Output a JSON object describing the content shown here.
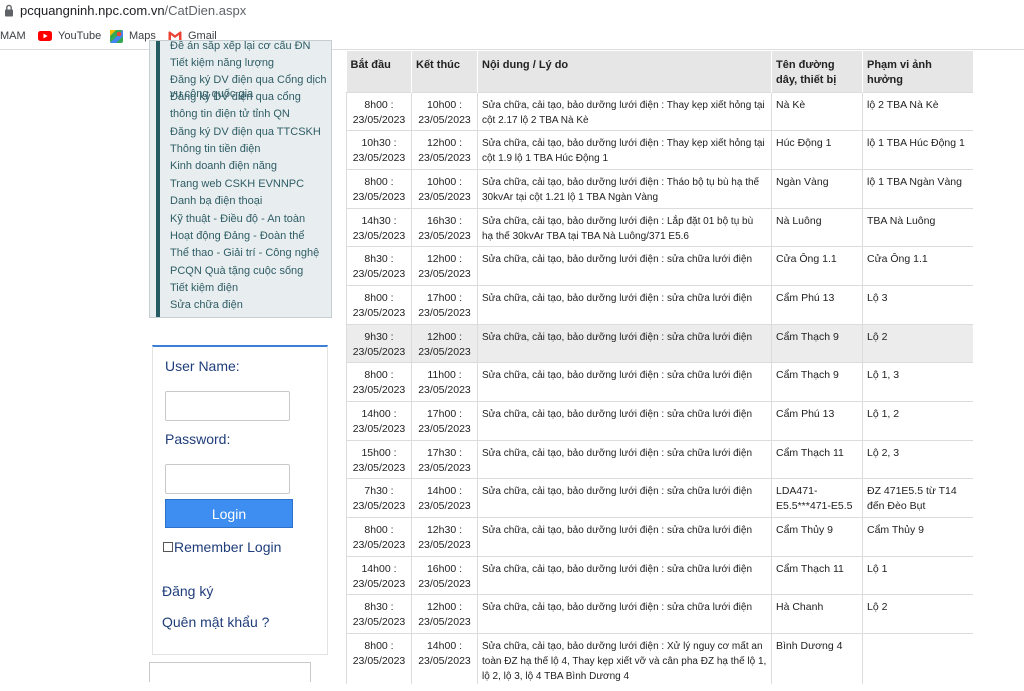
{
  "browser": {
    "url_host": "pcquangninh.npc.com.vn",
    "url_path": "/CatDien.aspx",
    "bookmarks": [
      {
        "label": "MAM",
        "icon": "none"
      },
      {
        "label": "YouTube",
        "icon": "youtube-icon"
      },
      {
        "label": "Maps",
        "icon": "maps-icon"
      },
      {
        "label": "Gmail",
        "icon": "gmail-icon"
      }
    ]
  },
  "sidebar": {
    "menu_items": [
      "Đề án sắp xếp lại cơ cấu ĐN",
      "Tiết kiệm năng lượng",
      "Đăng ký DV điện qua Cổng dịch vụ công quốc gia",
      "Đăng ký DV điện qua cổng",
      "thông tin điện tử tỉnh QN",
      "Đăng ký DV điện qua TTCSKH",
      "Thông tin tiền điện",
      "Kinh doanh điện năng",
      "Trang web CSKH EVNNPC",
      "Danh bạ điện thoại",
      "Kỹ thuật - Điều độ - An toàn",
      "Hoạt động Đảng - Đoàn thể",
      "Thể thao - Giải trí - Công nghệ",
      "PCQN Quà tặng cuộc sống",
      "Tiết kiệm điện",
      "Sửa chữa điện"
    ]
  },
  "login": {
    "username_label": "User Name:",
    "username_value": "",
    "password_label": "Password:",
    "password_value": "",
    "login_button": "Login",
    "remember_label": "Remember Login",
    "register_link": "Đăng ký",
    "forgot_link": "Quên mật khẩu ?"
  },
  "schedule": {
    "headers": [
      "Bắt đầu",
      "Kết thúc",
      "Nội dung / Lý do",
      "Tên đường dây, thiết bị",
      "Phạm vi ảnh hưởng"
    ],
    "rows": [
      {
        "start": "8h00 : 23/05/2023",
        "end": "10h00 : 23/05/2023",
        "content": "Sửa chữa, cải tạo, bảo dưỡng lưới điện : Thay kẹp xiết hỏng tại cột 2.17 lộ 2 TBA Nà Kè",
        "line": "Nà Kè",
        "scope": "lộ 2 TBA Nà Kè"
      },
      {
        "start": "10h30 : 23/05/2023",
        "end": "12h00 : 23/05/2023",
        "content": "Sửa chữa, cải tạo, bảo dưỡng lưới điện : Thay kẹp xiết hỏng tại cột 1.9 lộ 1 TBA Húc Động 1",
        "line": "Húc Động 1",
        "scope": "lộ 1 TBA Húc Động 1"
      },
      {
        "start": "8h00 : 23/05/2023",
        "end": "10h00 : 23/05/2023",
        "content": "Sửa chữa, cải tạo, bảo dưỡng lưới điện : Tháo bộ tụ bù hạ thế 30kvAr tại cột 1.21 lộ 1 TBA Ngàn Vàng",
        "line": "Ngàn Vàng",
        "scope": "lộ 1 TBA Ngàn Vàng"
      },
      {
        "start": "14h30 : 23/05/2023",
        "end": "16h30 : 23/05/2023",
        "content": "Sửa chữa, cải tạo, bảo dưỡng lưới điện : Lắp đặt 01 bộ tụ bù hạ thế 30kvAr TBA tại TBA Nà Luông/371 E5.6",
        "line": "Nà Luông",
        "scope": "TBA Nà Luông"
      },
      {
        "start": "8h30 : 23/05/2023",
        "end": "12h00 : 23/05/2023",
        "content": "Sửa chữa, cải tạo, bảo dưỡng lưới điện : sửa chữa lưới điện",
        "line": "Cửa Ông 1.1",
        "scope": "Cửa Ông 1.1"
      },
      {
        "start": "8h00 : 23/05/2023",
        "end": "17h00 : 23/05/2023",
        "content": "Sửa chữa, cải tạo, bảo dưỡng lưới điện : sửa chữa lưới điện",
        "line": "Cẩm Phú 13",
        "scope": "Lộ 3"
      },
      {
        "start": "9h30 : 23/05/2023",
        "end": "12h00 : 23/05/2023",
        "content": "Sửa chữa, cải tạo, bảo dưỡng lưới điện : sửa chữa lưới điện",
        "line": "Cẩm Thạch 9",
        "scope": "Lộ 2"
      },
      {
        "start": "8h00 : 23/05/2023",
        "end": "11h00 : 23/05/2023",
        "content": "Sửa chữa, cải tạo, bảo dưỡng lưới điện : sửa chữa lưới điện",
        "line": "Cẩm Thạch 9",
        "scope": "Lộ 1, 3"
      },
      {
        "start": "14h00 : 23/05/2023",
        "end": "17h00 : 23/05/2023",
        "content": "Sửa chữa, cải tạo, bảo dưỡng lưới điện : sửa chữa lưới điện",
        "line": "Cẩm Phú 13",
        "scope": "Lộ 1, 2"
      },
      {
        "start": "15h00 : 23/05/2023",
        "end": "17h30 : 23/05/2023",
        "content": "Sửa chữa, cải tạo, bảo dưỡng lưới điện : sửa chữa lưới điện",
        "line": "Cẩm Thạch 11",
        "scope": "Lộ 2, 3"
      },
      {
        "start": "7h30 : 23/05/2023",
        "end": "14h00 : 23/05/2023",
        "content": "Sửa chữa, cải tạo, bảo dưỡng lưới điện : sửa chữa lưới điện",
        "line": "LDA471-E5.5***471-E5.5",
        "scope": "ĐZ 471E5.5 từ T14 đến Đèo Bụt"
      },
      {
        "start": "8h00 : 23/05/2023",
        "end": "12h30 : 23/05/2023",
        "content": "Sửa chữa, cải tạo, bảo dưỡng lưới điện : sửa chữa lưới điện",
        "line": "Cẩm Thủy 9",
        "scope": "Cẩm Thủy 9"
      },
      {
        "start": "14h00 : 23/05/2023",
        "end": "16h00 : 23/05/2023",
        "content": "Sửa chữa, cải tạo, bảo dưỡng lưới điện : sửa chữa lưới điện",
        "line": "Cẩm Thạch 11",
        "scope": "Lộ 1"
      },
      {
        "start": "8h30 : 23/05/2023",
        "end": "12h00 : 23/05/2023",
        "content": "Sửa chữa, cải tạo, bảo dưỡng lưới điện : sửa chữa lưới điện",
        "line": "Hà Chanh",
        "scope": "Lộ 2"
      },
      {
        "start": "8h00 : 23/05/2023",
        "end": "14h00 : 23/05/2023",
        "content": "Sửa chữa, cải tạo, bảo dưỡng lưới điện : Xử lý nguy cơ mất an toàn ĐZ hạ thế lộ 4, Thay kẹp xiết vỡ và cân pha ĐZ hạ thế lộ 1, lộ 2, lộ 3, lộ 4 TBA Bình Dương 4",
        "line": "Bình Dương 4",
        "scope": ""
      }
    ]
  }
}
